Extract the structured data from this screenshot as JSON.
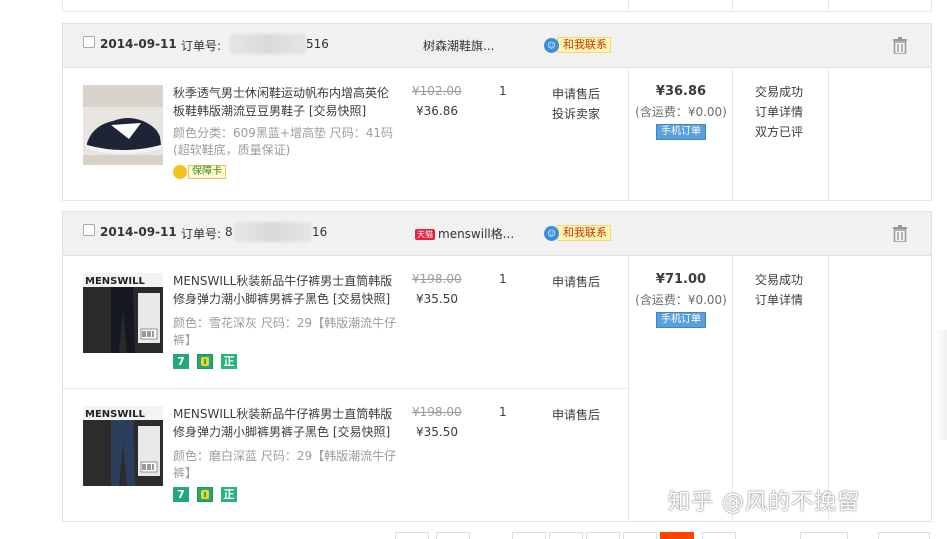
{
  "orders": [
    {
      "date": "2014-09-11",
      "order_no_label": "订单号:",
      "order_no_prefix": "",
      "order_no_suffix": "516",
      "shop": "树森潮鞋旗...",
      "contact_label": "和我联系",
      "items": [
        {
          "title": "秋季透气男士休闲鞋运动帆布内增高英伦板鞋韩版潮流豆豆男鞋子 [交易快照]",
          "props": "颜色分类：609黑蓝+增高垫  尺码：41码(超软鞋底，质量保证)",
          "original_price": "¥102.00",
          "price": "¥36.86",
          "quantity": "1",
          "service": [
            "申请售后",
            "投诉卖家"
          ],
          "guarantee": "保障卡"
        }
      ],
      "total": "¥36.86",
      "shipping": "(含运费：¥0.00)",
      "mobile_label": "手机订单",
      "status": [
        "交易成功",
        "订单详情",
        "双方已评"
      ]
    },
    {
      "date": "2014-09-11",
      "order_no_label": "订单号:",
      "order_no_prefix": "8",
      "order_no_suffix": "16",
      "shop_badge": "天猫",
      "shop": "menswill格...",
      "contact_label": "和我联系",
      "items": [
        {
          "title": "MENSWILL秋装新品牛仔裤男士直筒韩版修身弹力潮小脚裤男裤子黑色 [交易快照]",
          "props": "颜色：雪花深灰  尺码：29【韩版潮流牛仔裤】",
          "original_price": "¥198.00",
          "price": "¥35.50",
          "quantity": "1",
          "service": [
            "申请售后"
          ],
          "badges": [
            "7",
            "",
            "正"
          ]
        },
        {
          "title": "MENSWILL秋装新品牛仔裤男士直筒韩版修身弹力潮小脚裤男裤子黑色 [交易快照]",
          "props": "颜色：磨白深蓝  尺码：29【韩版潮流牛仔裤】",
          "original_price": "¥198.00",
          "price": "¥35.50",
          "quantity": "1",
          "service": [
            "申请售后"
          ],
          "badges": [
            "7",
            "",
            "正"
          ]
        }
      ],
      "total": "¥71.00",
      "shipping": "(含运费：¥0.00)",
      "mobile_label": "手机订单",
      "status": [
        "交易成功",
        "订单详情"
      ]
    }
  ],
  "watermark": "知乎 @风的不挽留",
  "thumb_jeans_text": "MENSWILL"
}
